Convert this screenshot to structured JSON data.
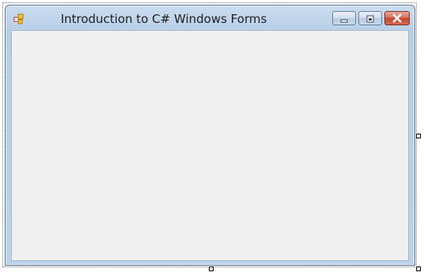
{
  "window": {
    "title": "Introduction to C# Windows Forms",
    "icon": "winforms-app-icon",
    "caption_buttons": [
      "minimize-icon",
      "maximize-icon",
      "close-icon"
    ]
  },
  "designer": {
    "resize_handles": [
      "right-middle",
      "bottom-middle",
      "bottom-right"
    ]
  },
  "colors": {
    "frame": "#bcd2ea",
    "client": "#f0f0f0",
    "close_button": "#c2452e"
  }
}
